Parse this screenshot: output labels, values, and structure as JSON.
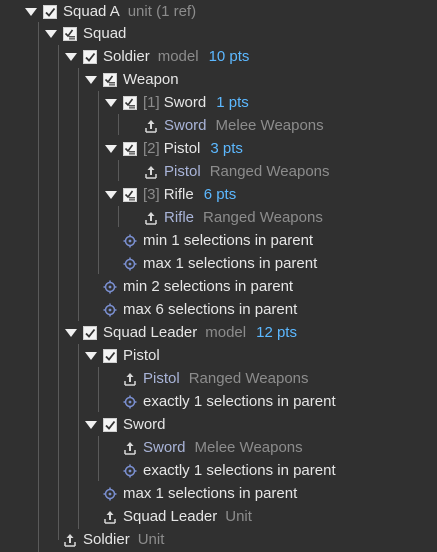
{
  "tree": {
    "squad_a": {
      "name": "Squad A",
      "kind": "unit (1 ref)"
    },
    "squad": {
      "name": "Squad"
    },
    "soldier": {
      "name": "Soldier",
      "kind": "model",
      "pts": "10 pts"
    },
    "weapon": {
      "name": "Weapon"
    },
    "sword_opt": {
      "idx": "[1]",
      "name": "Sword",
      "pts": "1 pts"
    },
    "sword_link": {
      "name": "Sword",
      "cat": "Melee Weapons"
    },
    "pistol_opt": {
      "idx": "[2]",
      "name": "Pistol",
      "pts": "3 pts"
    },
    "pistol_link": {
      "name": "Pistol",
      "cat": "Ranged Weapons"
    },
    "rifle_opt": {
      "idx": "[3]",
      "name": "Rifle",
      "pts": "6 pts"
    },
    "rifle_link": {
      "name": "Rifle",
      "cat": "Ranged Weapons"
    },
    "c_min1": "min 1 selections in parent",
    "c_max1": "max 1 selections in parent",
    "c_min2": "min 2 selections in parent",
    "c_max6": "max 6 selections in parent",
    "leader": {
      "name": "Squad Leader",
      "kind": "model",
      "pts": "12 pts"
    },
    "leader_pistol": {
      "name": "Pistol"
    },
    "leader_pistol_link": {
      "name": "Pistol",
      "cat": "Ranged Weapons"
    },
    "c_exact1_a": "exactly 1 selections in parent",
    "leader_sword": {
      "name": "Sword"
    },
    "leader_sword_link": {
      "name": "Sword",
      "cat": "Melee Weapons"
    },
    "c_exact1_b": "exactly 1 selections in parent",
    "c_max1_b": "max 1 selections in parent",
    "leader_unit_link": {
      "name": "Squad Leader",
      "kind": "Unit"
    },
    "soldier_unit_link": {
      "name": "Soldier",
      "kind": "Unit"
    }
  },
  "colors": {
    "background": "#303030",
    "points": "#5cb8ff",
    "link": "#a9b4d8",
    "muted": "#8c8c8c",
    "constraint_icon": "#7a8fd0"
  }
}
